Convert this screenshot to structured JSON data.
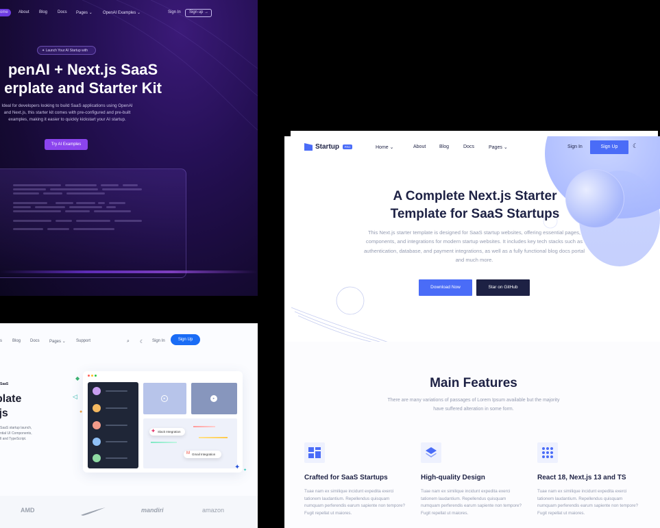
{
  "panel_dark": {
    "nav": [
      "ome",
      "About",
      "Blog",
      "Docs",
      "Pages",
      "OpenAI Examples",
      "Sign In",
      "Sign up"
    ],
    "badge": "Launch Your AI Startup with",
    "title_line1": "penAI + Next.js SaaS",
    "title_line2": "erplate and Starter Kit",
    "description": "Ideal for developers looking to build SaaS applications using OpenAI and Next.js, this starter kit comes with pre-configured and pre-built examples, making it easier to quickly kickstart your AI startup.",
    "cta": "Try AI Examples",
    "colors": {
      "accent": "#8b44ee",
      "bg": "#1d0c45"
    }
  },
  "panel_light": {
    "nav": [
      "s",
      "Blog",
      "Docs",
      "Pages",
      "Support",
      "Sign In",
      "Sign Up"
    ],
    "eyebrow": "SaaS",
    "title_line1": "plate",
    "title_line2": ".js",
    "desc_line1": "SaaS startup launch,",
    "desc_line2": "ntial UI Components,",
    "desc_line3": "ll and TypeScript.",
    "pill_slack": "Slack Integration",
    "pill_gmail": "Gmail Integration",
    "logos": [
      "AMD",
      "Nike",
      "mandiri",
      "amazon"
    ],
    "colors": {
      "accent": "#1a6cf5"
    }
  },
  "panel_startup": {
    "brand": "Startup",
    "brand_badge": "PRO",
    "nav": [
      "Home",
      "About",
      "Blog",
      "Docs",
      "Pages"
    ],
    "sign_in": "Sign In",
    "sign_up": "Sign Up",
    "hero_title_line1": "A Complete Next.js Starter",
    "hero_title_line2": "Template for SaaS Startups",
    "hero_subtitle": "This Next.js starter template is designed for SaaS startup websites, offering essential pages, components, and integrations for modern startup websites. It includes key tech stacks such as authentication, database, and payment integrations, as well as a fully functional blog docs portal and much more.",
    "btn_download": "Download Now",
    "btn_github": "Star on GitHub",
    "features_title": "Main Features",
    "features_subtitle": "There are many variations of passages of Lorem Ipsum available but the majority have suffered alteration in some form.",
    "features": [
      {
        "title": "Crafted for SaaS Startups",
        "icon": "grid-icon",
        "text": "Tuae nam ex similique incidunt expedita exerci tationem laudantium. Repellendus quisquam numquam perferendis earum sapiente non tempore? Fugit repellat ut maiores."
      },
      {
        "title": "High-quality Design",
        "icon": "layers-icon",
        "text": "Tuae nam ex similique incidunt expedita exerci tationem laudantium. Repellendus quisquam numquam perferendis earum sapiente non tempore? Fugit repellat ut maiores."
      },
      {
        "title": "React 18, Next.js 13 and TS",
        "icon": "dots-grid-icon",
        "text": "Tuae nam ex similique incidunt expedita exerci tationem laudantium. Repellendus quisquam numquam perferendis earum sapiente non tempore? Fugit repellat ut maiores."
      }
    ],
    "colors": {
      "primary": "#4a6cf7",
      "dark": "#1d2144",
      "muted": "#959cb1"
    }
  }
}
